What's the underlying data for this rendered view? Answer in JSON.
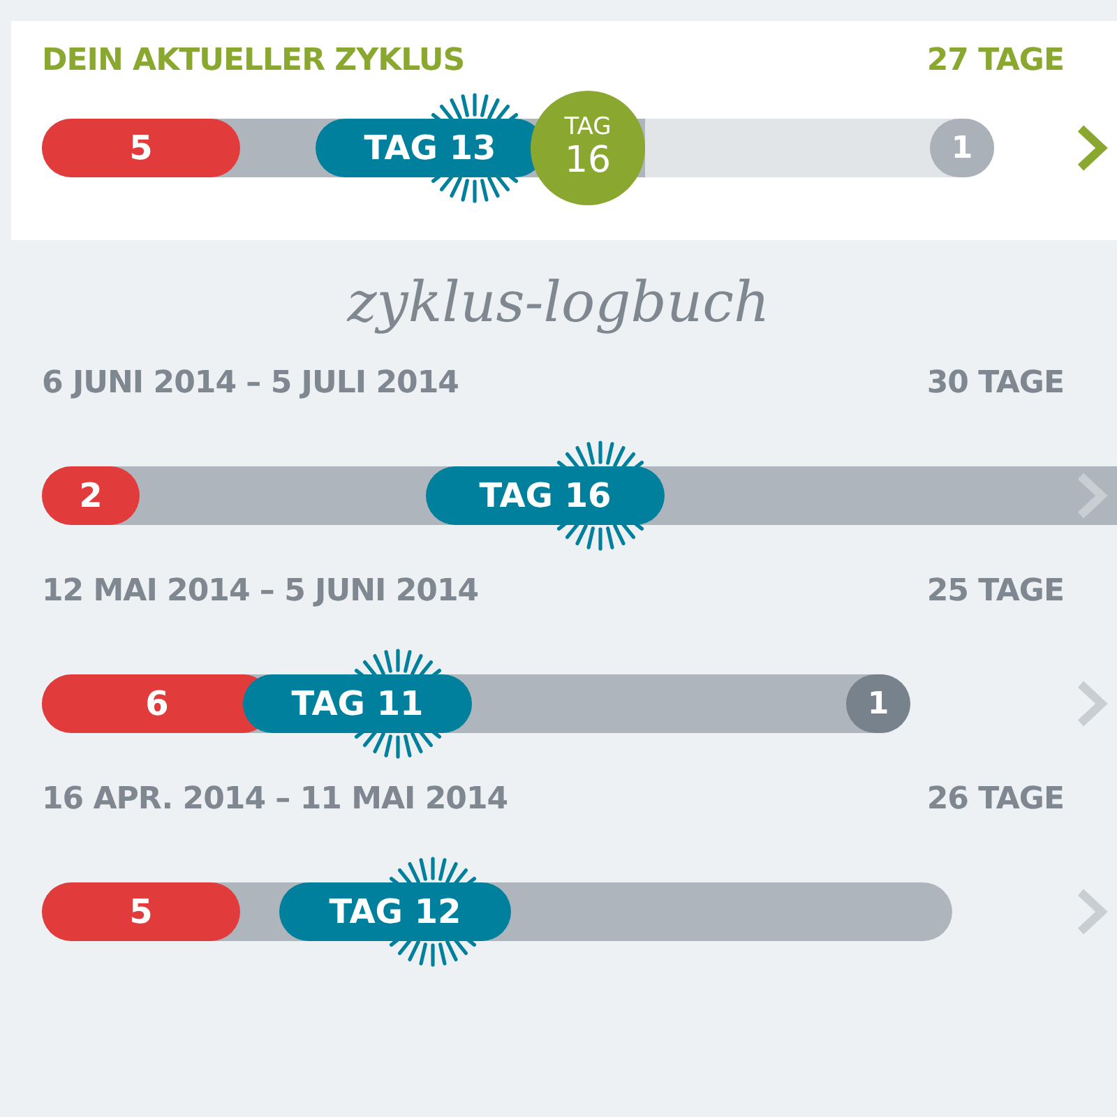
{
  "current": {
    "title": "DEIN AKTUELLER ZYKLUS",
    "days": "27 TAGE",
    "period": "5",
    "ovulation": "TAG 13",
    "today": {
      "label": "TAG",
      "day": "16"
    },
    "end_badge": "1"
  },
  "log_title": "zyklus-logbuch",
  "cycles": [
    {
      "range": "6 JUNI 2014 – 5 JULI 2014",
      "days": "30 TAGE",
      "period": "2",
      "ovulation": "TAG 16"
    },
    {
      "range": "12 MAI 2014 – 5 JUNI 2014",
      "days": "25 TAGE",
      "period": "6",
      "ovulation": "TAG 11",
      "end_badge": "1"
    },
    {
      "range": "16 APR. 2014 – 11 MAI 2014",
      "days": "26 TAGE",
      "period": "5",
      "ovulation": "TAG 12"
    }
  ]
}
